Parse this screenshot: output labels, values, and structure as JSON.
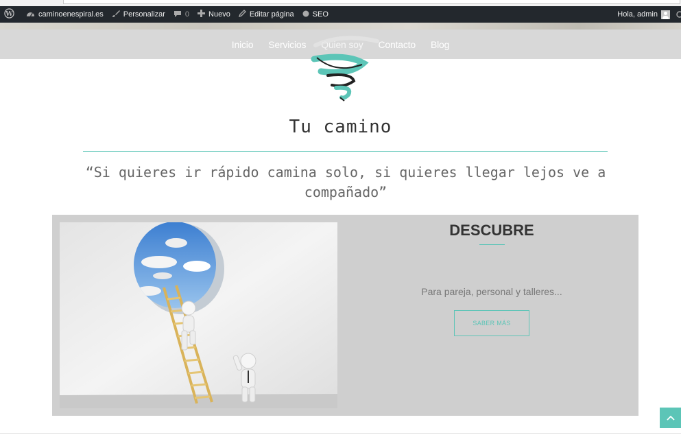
{
  "adminbar": {
    "site_name": "caminoenespiral.es",
    "customize": "Personalizar",
    "comments_count": "0",
    "new": "Nuevo",
    "edit_page": "Editar página",
    "seo": "SEO",
    "greeting": "Hola, admin"
  },
  "nav": {
    "items": [
      {
        "label": "Inicio"
      },
      {
        "label": "Servicios"
      },
      {
        "label": "Quien soy"
      },
      {
        "label": "Contacto"
      },
      {
        "label": "Blog"
      }
    ]
  },
  "hero": {
    "title": "Tu camino",
    "quote": "“Si quieres ir rápido camina solo, si quieres llegar lejos ve a compañado”"
  },
  "feature": {
    "heading": "DESCUBRE",
    "text": "Para pareja, personal y talleres...",
    "button": "SABER MÁS"
  },
  "colors": {
    "accent": "#5cc5b7",
    "adminbar": "#23282d",
    "nav_bg": "#d8d8d8",
    "panel_bg": "#cfcfcf"
  },
  "icons": {
    "wp": "wordpress-logo-icon",
    "dashboard": "dashboard-icon",
    "brush": "brush-icon",
    "comment": "comment-bubble-icon",
    "plus": "plus-icon",
    "pencil": "pencil-icon",
    "seo": "seo-dot-icon",
    "scroll": "chevron-up-icon"
  }
}
